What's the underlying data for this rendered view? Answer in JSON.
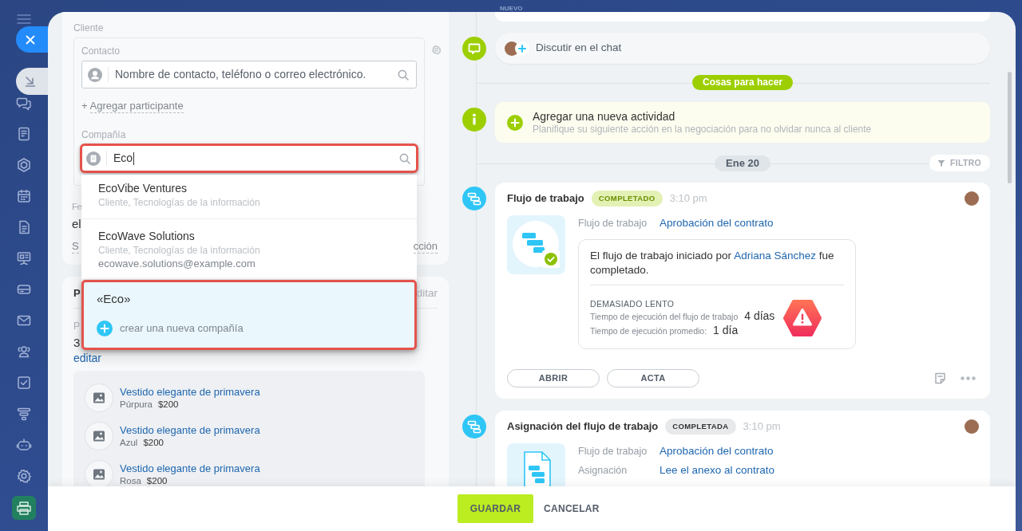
{
  "stage": {
    "label": "NUEVO"
  },
  "client": {
    "title": "Cliente",
    "contact": {
      "label": "Contacto",
      "placeholder": "Nombre de contacto, teléfono o correo electrónico."
    },
    "add_participant": {
      "sign": "+",
      "label": "Agregar participante"
    },
    "company": {
      "label": "Compañía",
      "value": "Eco",
      "highlighted": true
    },
    "covered_fields": {
      "label_start": "Fe",
      "value_start": "el",
      "link_start": "S",
      "link_end": "cción"
    }
  },
  "company_dropdown": {
    "results": [
      {
        "name": "EcoVibe Ventures",
        "subtitle": "Cliente, Tecnologías de la información"
      },
      {
        "name": "EcoWave Solutions",
        "subtitle": "Cliente, Tecnologías de la información",
        "email": "ecowave.solutions@example.com"
      }
    ],
    "create": {
      "query": "«Eco»",
      "action": "crear una nueva compañía",
      "highlighted": true
    }
  },
  "products_card": {
    "title_start": "P",
    "edit_end": "ditar",
    "field_label_start": "P",
    "quantity": "3",
    "edit_link": "editar",
    "products": [
      {
        "name": "Vestido elegante de primavera",
        "variant": "Púrpura",
        "price": "$200"
      },
      {
        "name": "Vestido elegante de primavera",
        "variant": "Azul",
        "price": "$200"
      },
      {
        "name": "Vestido elegante de primavera",
        "variant": "Rosa",
        "price": "$200"
      }
    ]
  },
  "timeline": {
    "chat": {
      "label": "Discutir en el chat"
    },
    "todo_label": "Cosas para hacer",
    "new_activity": {
      "title": "Agregar una nueva actividad",
      "hint": "Planifique su siguiente acción en la negociación para no olvidar nunca al cliente"
    },
    "date_label": "Ene 20",
    "filter_label": "FILTRO",
    "entries": [
      {
        "kind": "workflow",
        "title": "Flujo de trabajo",
        "status": {
          "label": "COMPLETADO",
          "kind": "success"
        },
        "time": "3:10 pm",
        "fields": [
          {
            "label": "Flujo de trabajo",
            "value": "Aprobación del contrato"
          }
        ],
        "result": {
          "text_before": "El flujo de trabajo iniciado por",
          "author": "Adriana Sánchez",
          "text_after": "fue completado.",
          "alert": "DEMASIADO LENTO",
          "metrics": [
            {
              "label": "Tiempo de ejecución del flujo de trabajo",
              "value": "4 días"
            },
            {
              "label": "Tiempo de ejecución promedio:",
              "value": "1 día"
            }
          ]
        },
        "buttons": [
          "ABRIR",
          "ACTA"
        ]
      },
      {
        "kind": "assignment",
        "title": "Asignación del flujo de trabajo",
        "status": {
          "label": "COMPLETADA",
          "kind": "neutral"
        },
        "time": "3:10 pm",
        "fields": [
          {
            "label": "Flujo de trabajo",
            "value": "Aprobación del contrato"
          },
          {
            "label": "Asignación",
            "value": "Lee el anexo al contrato"
          }
        ]
      }
    ]
  },
  "footer": {
    "buttons": [
      {
        "label": "GUARDAR",
        "kind": "primary"
      },
      {
        "label": "CANCELAR",
        "kind": "link"
      }
    ]
  }
}
